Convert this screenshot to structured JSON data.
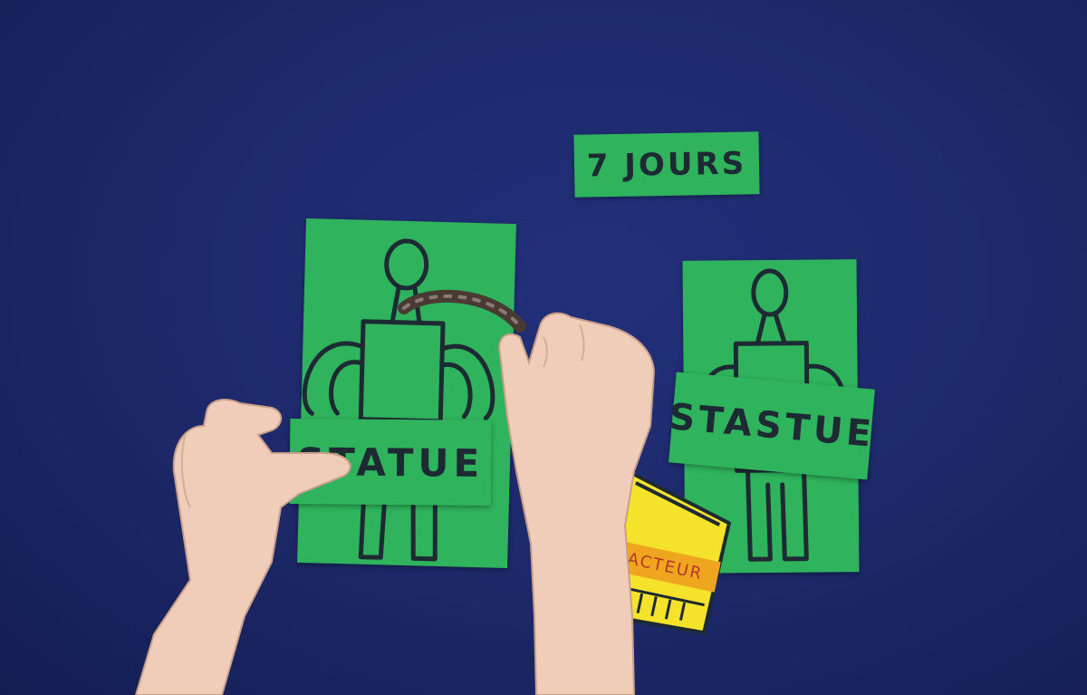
{
  "scene": {
    "background_color": "#1c2868",
    "paper_color": "#2fb35c",
    "yellow_card_color": "#f4e32a",
    "orange_strip_color": "#f0a521",
    "marker_color": "#1d2a33",
    "skin_color": "#efcdb8"
  },
  "cards": {
    "days": {
      "text": "7 JOURS"
    },
    "left_statue_banner": {
      "text": "STATUE"
    },
    "right_statue_banner": {
      "text": "STASTUE"
    },
    "yellow_card": {
      "text": "ACTEUR"
    }
  }
}
